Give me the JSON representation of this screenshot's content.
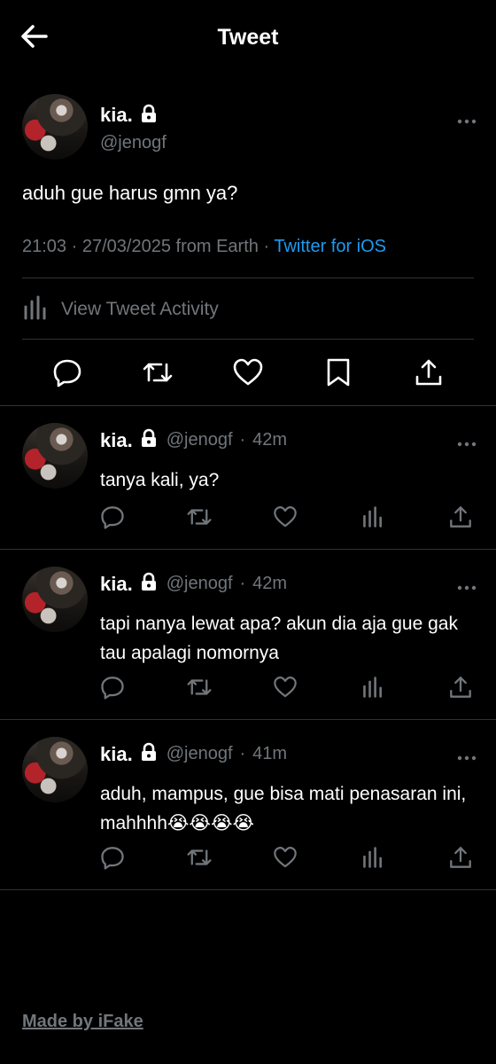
{
  "header": {
    "title": "Tweet"
  },
  "tweet": {
    "name": "kia.",
    "handle": "@jenogf",
    "text": "aduh gue harus gmn ya?",
    "time": "21:03",
    "sep": "·",
    "date": "27/03/2025",
    "from": "from Earth",
    "source": "Twitter for iOS",
    "activity_label": "View Tweet Activity"
  },
  "replies": [
    {
      "name": "kia.",
      "handle": "@jenogf",
      "sep": "·",
      "age": "42m",
      "text": "tanya kali, ya?"
    },
    {
      "name": "kia.",
      "handle": "@jenogf",
      "sep": "·",
      "age": "42m",
      "text": "tapi nanya lewat apa? akun dia aja gue gak tau apalagi nomornya"
    },
    {
      "name": "kia.",
      "handle": "@jenogf",
      "sep": "·",
      "age": "41m",
      "text": "aduh, mampus, gue bisa mati penasaran ini, mahhhh😭😭😭😭"
    }
  ],
  "footer": {
    "label": "Made by iFake"
  },
  "colors": {
    "background": "#000000",
    "muted": "#71767b",
    "link": "#1d9bf0",
    "divider": "#2f3336"
  },
  "icons": [
    "back-arrow-icon",
    "lock-icon",
    "more-icon",
    "activity-chart-icon",
    "reply-icon",
    "retweet-icon",
    "like-icon",
    "bookmark-icon",
    "share-icon"
  ]
}
